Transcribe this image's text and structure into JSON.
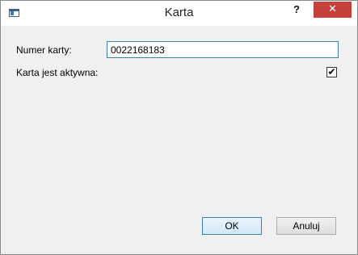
{
  "window": {
    "title": "Karta",
    "help_label": "?",
    "close_label": "✕",
    "app_icon": "window-app-icon"
  },
  "form": {
    "card_number_label": "Numer karty:",
    "card_number_value": "0022168183",
    "active_label": "Karta jest aktywna:",
    "active_checked": true,
    "active_mark": "✔"
  },
  "buttons": {
    "ok_label": "OK",
    "cancel_label": "Anuluj"
  },
  "colors": {
    "close_button": "#c7413c",
    "focus_border": "#3c7fb1"
  }
}
